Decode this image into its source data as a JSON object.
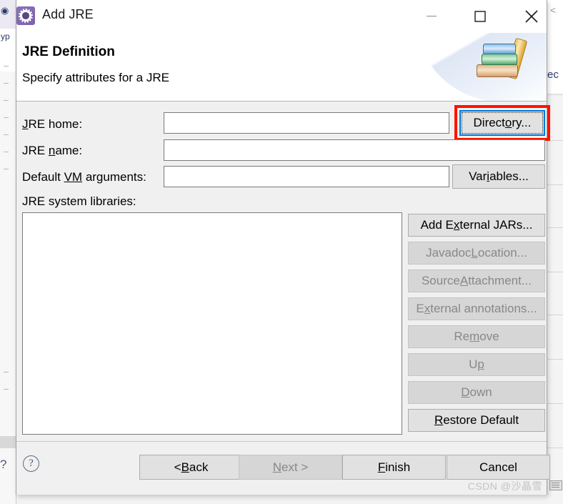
{
  "window": {
    "title": "Add JRE",
    "icon": "jre-gear-icon",
    "controls": {
      "minimize": "minimize-icon",
      "maximize": "maximize-icon",
      "close": "close-icon"
    }
  },
  "header": {
    "title": "JRE Definition",
    "subtitle": "Specify attributes for a JRE",
    "art_icon": "book-stack-icon"
  },
  "form": {
    "jre_home": {
      "label_pre": "",
      "label_mnemonic": "J",
      "label_post": "RE home:",
      "value": "",
      "placeholder": ""
    },
    "jre_name": {
      "label_pre": "JRE ",
      "label_mnemonic": "n",
      "label_post": "ame:",
      "value": "",
      "placeholder": ""
    },
    "vm_args": {
      "label_pre": "Default ",
      "label_mnemonic": "VM",
      "label_post": " arguments:",
      "value": "",
      "placeholder": ""
    },
    "libraries_label": "JRE system libraries:",
    "libraries_items": []
  },
  "side_buttons": {
    "directory": {
      "pre": "Direct",
      "mn": "o",
      "post": "ry...",
      "enabled": true,
      "focused": true,
      "highlighted": true
    },
    "variables": {
      "pre": "Var",
      "mn": "i",
      "post": "ables...",
      "enabled": true,
      "focused": false,
      "highlighted": false
    },
    "add_external_jars": {
      "pre": "Add E",
      "mn": "x",
      "post": "ternal JARs...",
      "enabled": true,
      "focused": false,
      "highlighted": false
    },
    "javadoc_location": {
      "pre": "Javadoc ",
      "mn": "L",
      "post": "ocation...",
      "enabled": false,
      "focused": false,
      "highlighted": false
    },
    "source_attachment": {
      "pre": "Source ",
      "mn": "A",
      "post": "ttachment...",
      "enabled": false,
      "focused": false,
      "highlighted": false
    },
    "external_annotations": {
      "pre": "E",
      "mn": "x",
      "post": "ternal annotations...",
      "enabled": false,
      "focused": false,
      "highlighted": false
    },
    "remove": {
      "pre": "Re",
      "mn": "m",
      "post": "ove",
      "enabled": false,
      "focused": false,
      "highlighted": false
    },
    "up": {
      "pre": "U",
      "mn": "p",
      "post": "",
      "enabled": false,
      "focused": false,
      "highlighted": false
    },
    "down": {
      "pre": "",
      "mn": "D",
      "post": "own",
      "enabled": false,
      "focused": false,
      "highlighted": false
    },
    "restore_default": {
      "pre": "",
      "mn": "R",
      "post": "estore Default",
      "enabled": true,
      "focused": false,
      "highlighted": false
    }
  },
  "footer": {
    "help_glyph": "?",
    "back": {
      "pre": "< ",
      "mn": "B",
      "post": "ack",
      "enabled": true
    },
    "next": {
      "pre": "",
      "mn": "N",
      "post": "ext >",
      "enabled": false
    },
    "finish": {
      "pre": "",
      "mn": "F",
      "post": "inish",
      "enabled": true
    },
    "cancel": {
      "pre": "Cancel",
      "mn": "",
      "post": "",
      "enabled": true
    },
    "watermark": "CSDN @沙晶雪"
  },
  "colors": {
    "dialog_bg": "#f0f0f0",
    "header_bg": "#ffffff",
    "focus_blue": "#0078d7",
    "annotation_red": "#ff1100",
    "disabled_text": "#888888"
  }
}
